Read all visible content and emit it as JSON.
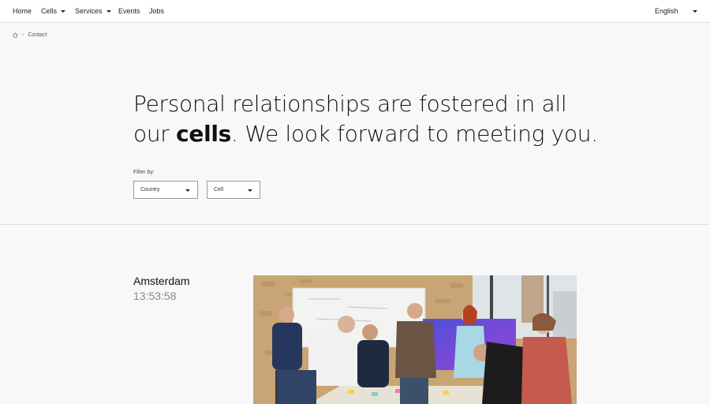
{
  "nav": {
    "items": [
      {
        "label": "Home"
      },
      {
        "label": "Cells"
      },
      {
        "label": "Services"
      },
      {
        "label": "Events"
      },
      {
        "label": "Jobs"
      }
    ],
    "language": "English"
  },
  "breadcrumb": {
    "current": "Contact"
  },
  "hero": {
    "line1": "Personal relationships are fostered in all",
    "line2_pre": "our ",
    "line2_bold": "cells",
    "line2_post": ". We look forward to meeting you."
  },
  "filter": {
    "label": "Filter by:",
    "country_value": "Country",
    "cell_value": "Cell"
  },
  "office": {
    "city": "Amsterdam",
    "time": "13:53:58"
  }
}
